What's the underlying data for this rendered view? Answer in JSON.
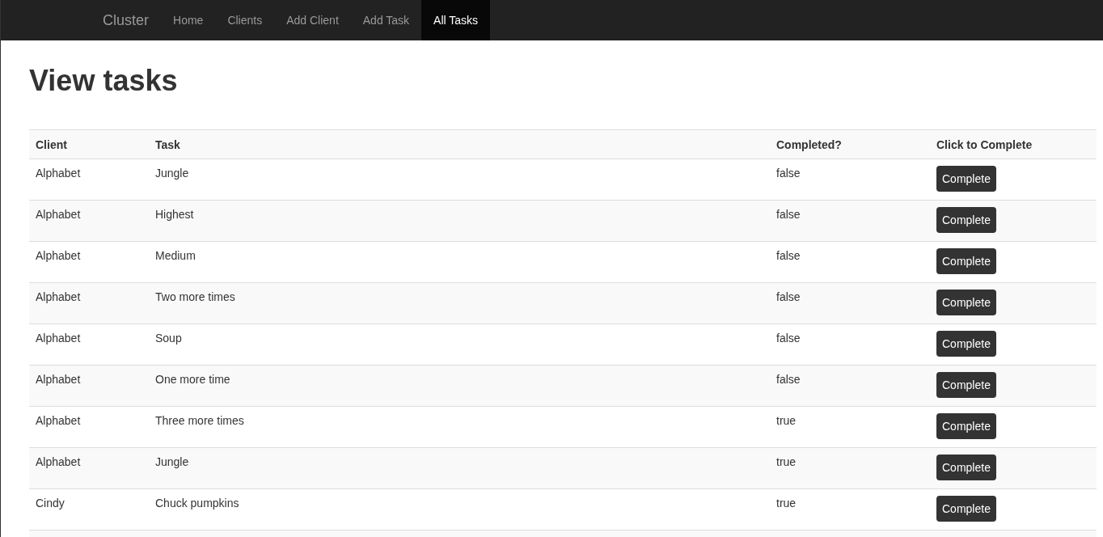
{
  "navbar": {
    "brand": "Cluster",
    "items": [
      {
        "label": "Home",
        "selected": false
      },
      {
        "label": "Clients",
        "selected": false
      },
      {
        "label": "Add Client",
        "selected": false
      },
      {
        "label": "Add Task",
        "selected": false
      },
      {
        "label": "All Tasks",
        "selected": true
      }
    ]
  },
  "title": "View tasks",
  "table": {
    "columns": [
      "Client",
      "Task",
      "Completed?",
      "Click to Complete"
    ],
    "rows": [
      {
        "client": "Alphabet",
        "task": "Jungle",
        "completed": "false",
        "action": "Complete"
      },
      {
        "client": "Alphabet",
        "task": "Highest",
        "completed": "false",
        "action": "Complete"
      },
      {
        "client": "Alphabet",
        "task": "Medium",
        "completed": "false",
        "action": "Complete"
      },
      {
        "client": "Alphabet",
        "task": "Two more times",
        "completed": "false",
        "action": "Complete"
      },
      {
        "client": "Alphabet",
        "task": "Soup",
        "completed": "false",
        "action": "Complete"
      },
      {
        "client": "Alphabet",
        "task": "One more time",
        "completed": "false",
        "action": "Complete"
      },
      {
        "client": "Alphabet",
        "task": "Three more times",
        "completed": "true",
        "action": "Complete"
      },
      {
        "client": "Alphabet",
        "task": "Jungle",
        "completed": "true",
        "action": "Complete"
      },
      {
        "client": "Cindy",
        "task": "Chuck pumpkins",
        "completed": "true",
        "action": "Complete"
      }
    ]
  }
}
